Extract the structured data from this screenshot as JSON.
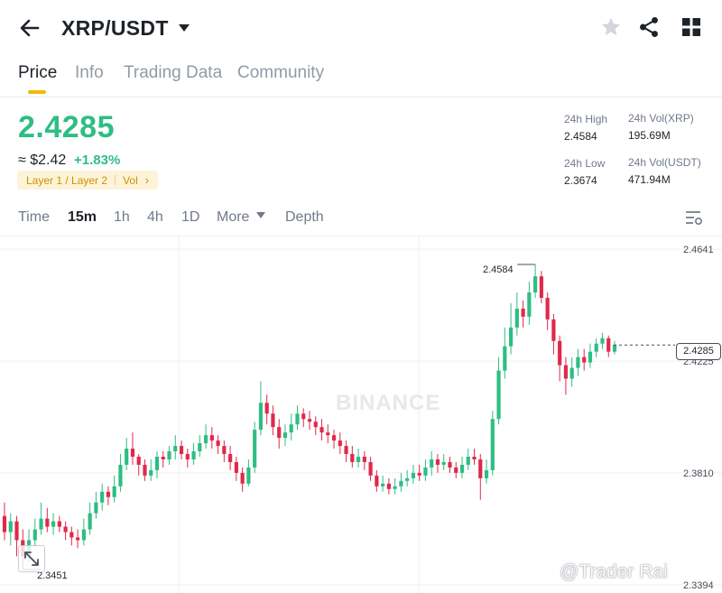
{
  "header": {
    "pair": "XRP/USDT",
    "back_icon": "arrow-left-icon",
    "dropdown_icon": "caret-down-icon",
    "favorite_icon": "star-icon",
    "share_icon": "share-icon",
    "grid_icon": "grid-icon"
  },
  "tabs": [
    "Price",
    "Info",
    "Trading Data",
    "Community"
  ],
  "price": {
    "last": "2.4285",
    "usd": "≈ $2.42",
    "change": "+1.83%",
    "tags": [
      "Layer 1 / Layer 2",
      "Vol"
    ],
    "tag_chevron": "›"
  },
  "stats": {
    "high_label": "24h High",
    "high_value": "2.4584",
    "vol_xrp_label": "24h Vol(XRP)",
    "vol_xrp_value": "195.69M",
    "low_label": "24h Low",
    "low_value": "2.3674",
    "vol_usdt_label": "24h Vol(USDT)",
    "vol_usdt_value": "471.94M"
  },
  "intervals": {
    "items": [
      "Time",
      "15m",
      "1h",
      "4h",
      "1D",
      "More",
      "Depth"
    ],
    "active": "15m",
    "settings_icon": "chart-settings-icon"
  },
  "chart": {
    "y_labels": [
      "2.4641",
      "2.4225",
      "2.3810",
      "2.3394"
    ],
    "current_price": "2.4285",
    "high_marker": "2.4584",
    "low_marker": "2.3451",
    "watermark": "BINANCE",
    "credit": "@Trader Rai",
    "expand_icon": "expand-icon"
  },
  "colors": {
    "up": "#2ebd85",
    "down": "#e0294a",
    "accent": "#f0b90b"
  },
  "chart_data": {
    "type": "candlestick",
    "interval": "15m",
    "ylim": [
      2.3394,
      2.4641
    ],
    "y_ticks": [
      2.4641,
      2.4225,
      2.381,
      2.3394
    ],
    "last": 2.4285,
    "high": 2.4584,
    "low": 2.3451,
    "candles": [
      [
        2.365,
        2.359,
        2.37,
        2.356
      ],
      [
        2.359,
        2.363,
        2.366,
        2.354
      ],
      [
        2.363,
        2.356,
        2.365,
        2.35
      ],
      [
        2.356,
        2.35,
        2.36,
        2.3451
      ],
      [
        2.35,
        2.356,
        2.36,
        2.348
      ],
      [
        2.356,
        2.36,
        2.364,
        2.353
      ],
      [
        2.36,
        2.364,
        2.37,
        2.358
      ],
      [
        2.364,
        2.361,
        2.368,
        2.359
      ],
      [
        2.361,
        2.363,
        2.366,
        2.358
      ],
      [
        2.363,
        2.361,
        2.365,
        2.359
      ],
      [
        2.361,
        2.359,
        2.363,
        2.356
      ],
      [
        2.359,
        2.357,
        2.361,
        2.354
      ],
      [
        2.357,
        2.356,
        2.36,
        2.353
      ],
      [
        2.356,
        2.36,
        2.364,
        2.354
      ],
      [
        2.36,
        2.366,
        2.37,
        2.358
      ],
      [
        2.366,
        2.37,
        2.374,
        2.364
      ],
      [
        2.37,
        2.374,
        2.377,
        2.367
      ],
      [
        2.374,
        2.372,
        2.376,
        2.369
      ],
      [
        2.372,
        2.376,
        2.38,
        2.37
      ],
      [
        2.376,
        2.384,
        2.388,
        2.374
      ],
      [
        2.384,
        2.39,
        2.394,
        2.382
      ],
      [
        2.39,
        2.387,
        2.396,
        2.384
      ],
      [
        2.387,
        2.384,
        2.388,
        2.38
      ],
      [
        2.384,
        2.38,
        2.386,
        2.378
      ],
      [
        2.38,
        2.382,
        2.386,
        2.378
      ],
      [
        2.382,
        2.387,
        2.389,
        2.379
      ],
      [
        2.387,
        2.386,
        2.389,
        2.383
      ],
      [
        2.386,
        2.389,
        2.391,
        2.384
      ],
      [
        2.389,
        2.391,
        2.395,
        2.386
      ],
      [
        2.391,
        2.388,
        2.393,
        2.386
      ],
      [
        2.388,
        2.386,
        2.39,
        2.383
      ],
      [
        2.386,
        2.389,
        2.392,
        2.384
      ],
      [
        2.389,
        2.392,
        2.395,
        2.387
      ],
      [
        2.392,
        2.395,
        2.399,
        2.39
      ],
      [
        2.395,
        2.393,
        2.398,
        2.39
      ],
      [
        2.393,
        2.391,
        2.395,
        2.388
      ],
      [
        2.391,
        2.388,
        2.393,
        2.385
      ],
      [
        2.388,
        2.385,
        2.391,
        2.382
      ],
      [
        2.385,
        2.381,
        2.387,
        2.378
      ],
      [
        2.381,
        2.377,
        2.383,
        2.374
      ],
      [
        2.377,
        2.383,
        2.386,
        2.376
      ],
      [
        2.383,
        2.397,
        2.4,
        2.381
      ],
      [
        2.397,
        2.407,
        2.415,
        2.395
      ],
      [
        2.407,
        2.403,
        2.41,
        2.399
      ],
      [
        2.403,
        2.398,
        2.406,
        2.395
      ],
      [
        2.398,
        2.394,
        2.401,
        2.39
      ],
      [
        2.394,
        2.396,
        2.399,
        2.391
      ],
      [
        2.396,
        2.399,
        2.403,
        2.393
      ],
      [
        2.399,
        2.403,
        2.406,
        2.397
      ],
      [
        2.403,
        2.401,
        2.405,
        2.398
      ],
      [
        2.401,
        2.4,
        2.404,
        2.397
      ],
      [
        2.4,
        2.398,
        2.402,
        2.395
      ],
      [
        2.398,
        2.396,
        2.401,
        2.393
      ],
      [
        2.396,
        2.395,
        2.399,
        2.392
      ],
      [
        2.395,
        2.393,
        2.397,
        2.39
      ],
      [
        2.393,
        2.391,
        2.396,
        2.388
      ],
      [
        2.391,
        2.388,
        2.393,
        2.385
      ],
      [
        2.388,
        2.385,
        2.391,
        2.383
      ],
      [
        2.385,
        2.387,
        2.39,
        2.383
      ],
      [
        2.387,
        2.385,
        2.389,
        2.382
      ],
      [
        2.385,
        2.38,
        2.387,
        2.378
      ],
      [
        2.38,
        2.376,
        2.382,
        2.374
      ],
      [
        2.376,
        2.377,
        2.38,
        2.374
      ],
      [
        2.377,
        2.375,
        2.379,
        2.373
      ],
      [
        2.375,
        2.376,
        2.379,
        2.373
      ],
      [
        2.376,
        2.378,
        2.381,
        2.374
      ],
      [
        2.378,
        2.379,
        2.382,
        2.376
      ],
      [
        2.379,
        2.381,
        2.384,
        2.377
      ],
      [
        2.381,
        2.38,
        2.384,
        2.378
      ],
      [
        2.38,
        2.383,
        2.386,
        2.378
      ],
      [
        2.383,
        2.386,
        2.389,
        2.38
      ],
      [
        2.386,
        2.384,
        2.388,
        2.381
      ],
      [
        2.384,
        2.385,
        2.388,
        2.382
      ],
      [
        2.385,
        2.383,
        2.387,
        2.381
      ],
      [
        2.383,
        2.381,
        2.385,
        2.379
      ],
      [
        2.381,
        2.384,
        2.387,
        2.379
      ],
      [
        2.384,
        2.387,
        2.39,
        2.382
      ],
      [
        2.387,
        2.386,
        2.39,
        2.384
      ],
      [
        2.386,
        2.379,
        2.388,
        2.371
      ],
      [
        2.379,
        2.382,
        2.386,
        2.377
      ],
      [
        2.382,
        2.401,
        2.404,
        2.38
      ],
      [
        2.401,
        2.419,
        2.424,
        2.399
      ],
      [
        2.419,
        2.428,
        2.435,
        2.416
      ],
      [
        2.428,
        2.435,
        2.444,
        2.425
      ],
      [
        2.435,
        2.442,
        2.448,
        2.432
      ],
      [
        2.442,
        2.439,
        2.445,
        2.435
      ],
      [
        2.439,
        2.448,
        2.452,
        2.436
      ],
      [
        2.448,
        2.454,
        2.4584,
        2.446
      ],
      [
        2.454,
        2.446,
        2.456,
        2.444
      ],
      [
        2.446,
        2.438,
        2.448,
        2.434
      ],
      [
        2.438,
        2.43,
        2.44,
        2.425
      ],
      [
        2.43,
        2.421,
        2.432,
        2.415
      ],
      [
        2.421,
        2.416,
        2.424,
        2.41
      ],
      [
        2.416,
        2.42,
        2.424,
        2.413
      ],
      [
        2.42,
        2.424,
        2.427,
        2.417
      ],
      [
        2.424,
        2.422,
        2.427,
        2.419
      ],
      [
        2.422,
        2.426,
        2.429,
        2.42
      ],
      [
        2.426,
        2.429,
        2.431,
        2.424
      ],
      [
        2.429,
        2.431,
        2.433,
        2.427
      ],
      [
        2.431,
        2.426,
        2.432,
        2.424
      ],
      [
        2.426,
        2.4285,
        2.43,
        2.425
      ]
    ],
    "candle_fields": [
      "open",
      "close",
      "high",
      "low"
    ]
  }
}
